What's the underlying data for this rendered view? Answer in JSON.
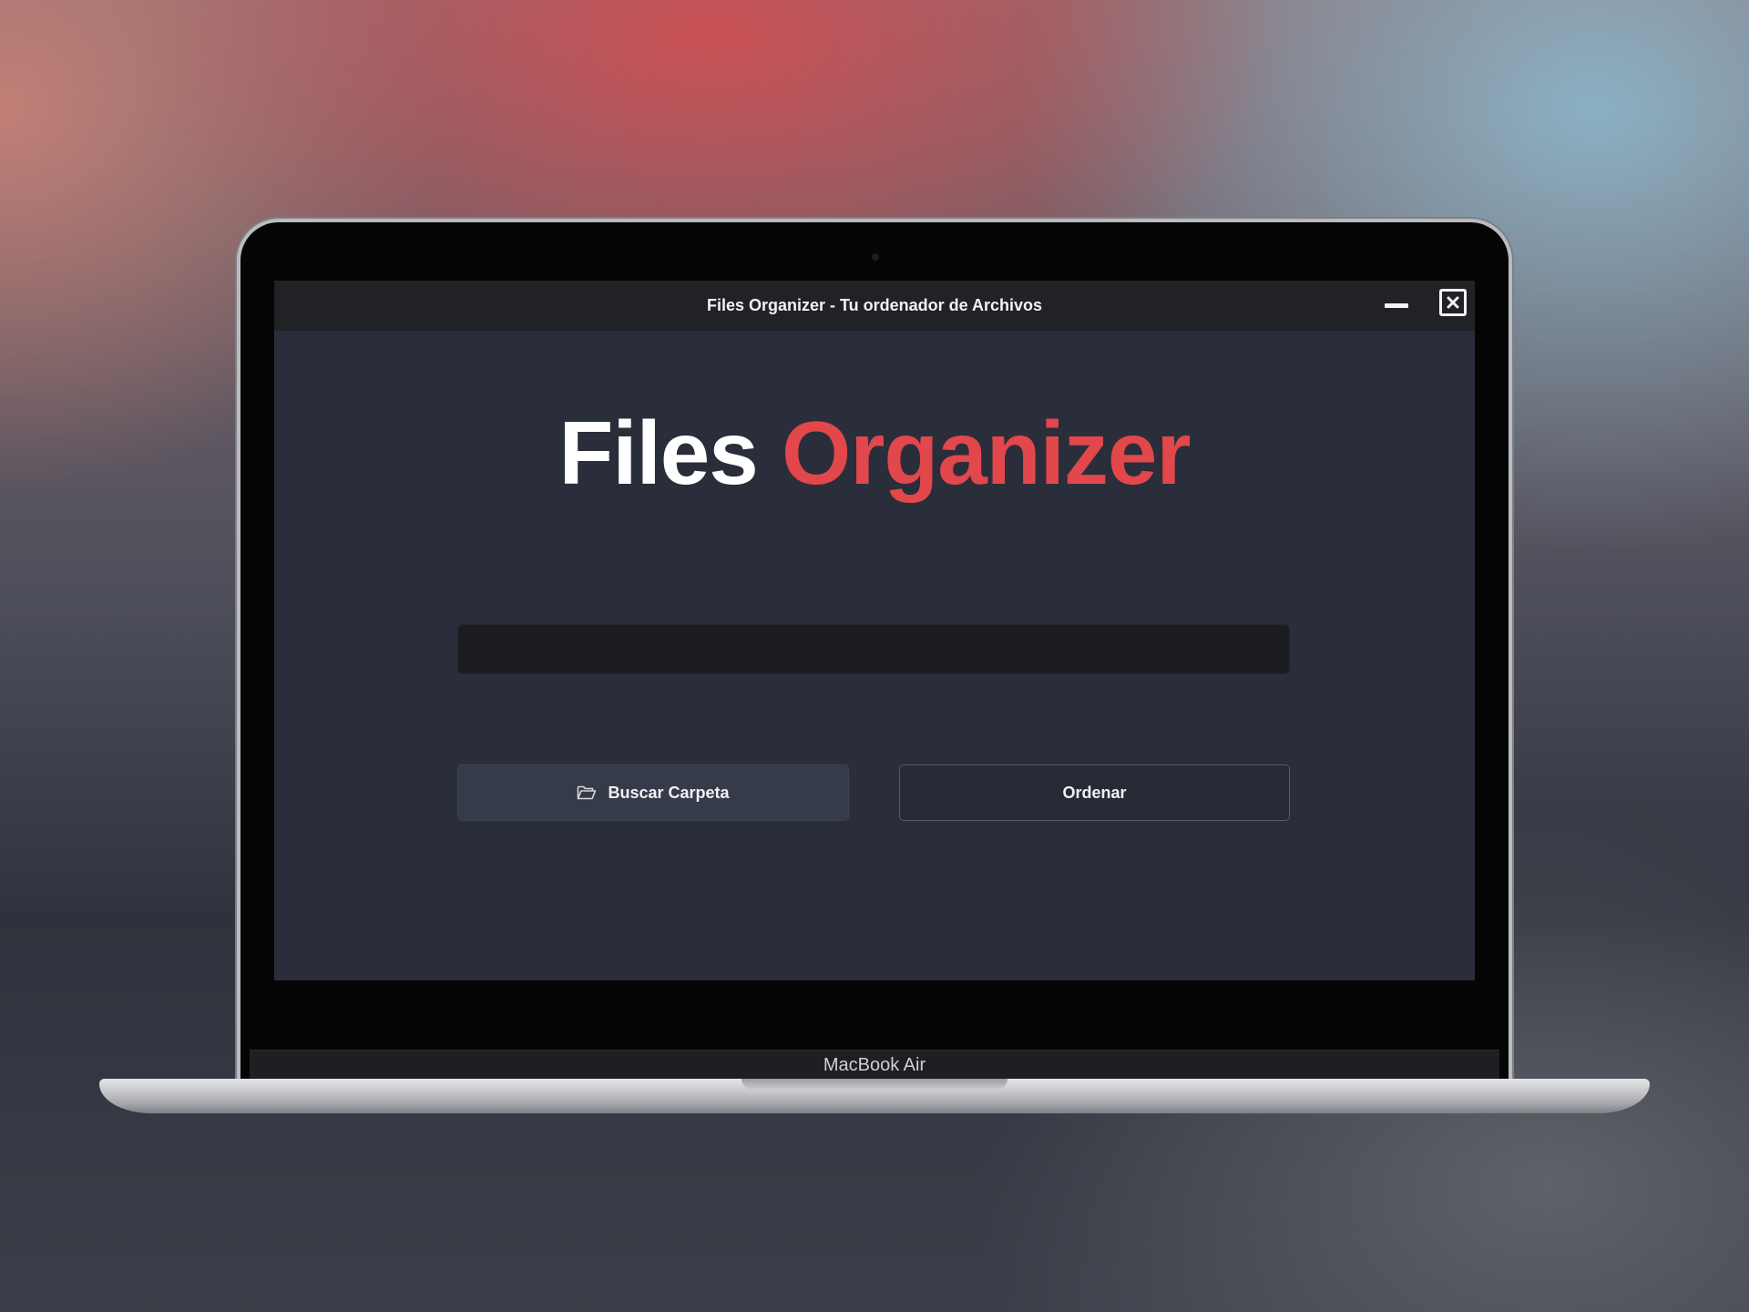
{
  "window": {
    "title": "Files Organizer - Tu ordenador de Archivos",
    "minimize_icon": "minimize-icon",
    "close_icon": "close-icon"
  },
  "app": {
    "heading_primary": "Files",
    "heading_accent": "Organizer",
    "accent_color": "#e2474b",
    "folder_path": {
      "value": "",
      "placeholder": ""
    },
    "buttons": {
      "browse_label": "Buscar Carpeta",
      "browse_icon": "folder-open-icon",
      "sort_label": "Ordenar"
    }
  },
  "device": {
    "model_label": "MacBook Air"
  }
}
